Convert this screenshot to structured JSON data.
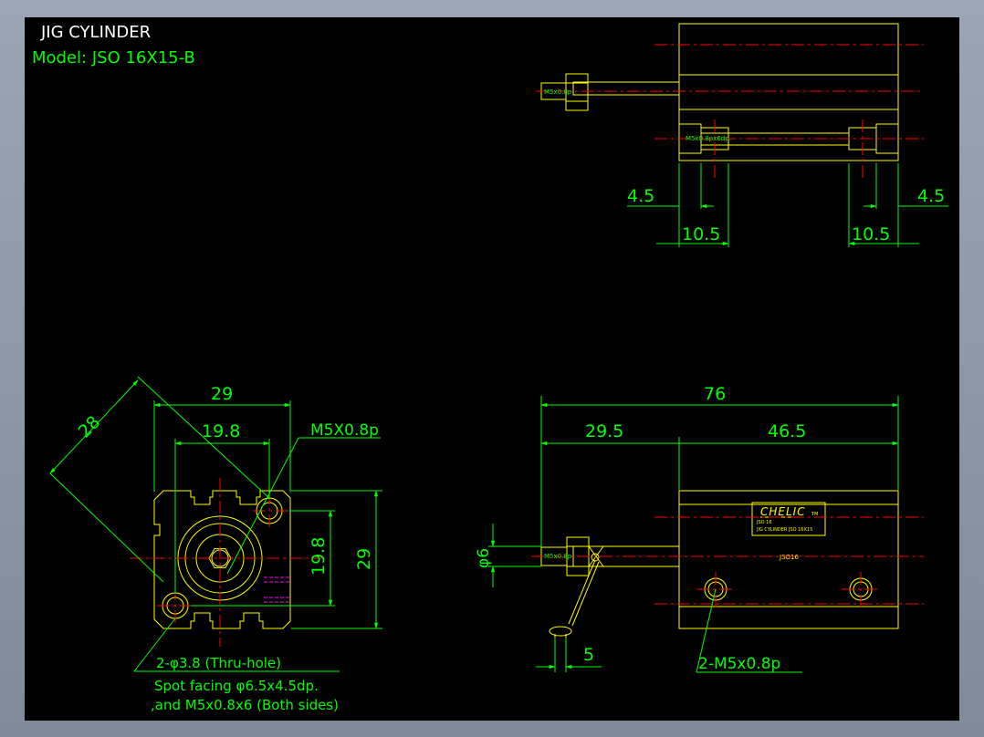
{
  "title": "JIG CYLINDER",
  "model": "Model:  JSO 16X15-B",
  "colors": {
    "background": "#000000",
    "frame": "#9aa6b4",
    "part": "#ffff00",
    "dimension": "#00ff00",
    "centerline": "#ff0000",
    "title": "#ffffff",
    "hatch": "#ff00ff"
  },
  "top_view": {
    "port_label_rod": "M5x0.8p",
    "port_label_mount": "M5x0.8px6dp.",
    "dim_left_offset": "4.5",
    "dim_right_offset": "4.5",
    "dim_left_spacing": "10.5",
    "dim_right_spacing": "10.5"
  },
  "end_view": {
    "dim_diagonal": "28",
    "dim_width": "29",
    "dim_inner_width": "19.8",
    "dim_inner_height": "19.8",
    "dim_height": "29",
    "callout_thread": "M5X0.8p",
    "note_hole": "2-φ3.8 (Thru-hole)",
    "note_spot": "Spot facing φ6.5x4.5dp.",
    "note_sides": ",and M5x0.8x6 (Both sides)"
  },
  "side_view": {
    "dim_total": "76",
    "dim_rod": "29.5",
    "dim_body": "46.5",
    "dim_rod_dia": "φ6",
    "dim_nut": "5",
    "port_label": "M5x0.8p",
    "callout_ports": "2-M5x0.8p",
    "brand": "CHELIC",
    "brand_sup": "TM",
    "plate_line1": "JSO 16",
    "plate_line2": "JIG CYLINDER   JSO 16X15",
    "body_marking": "JSO16"
  }
}
